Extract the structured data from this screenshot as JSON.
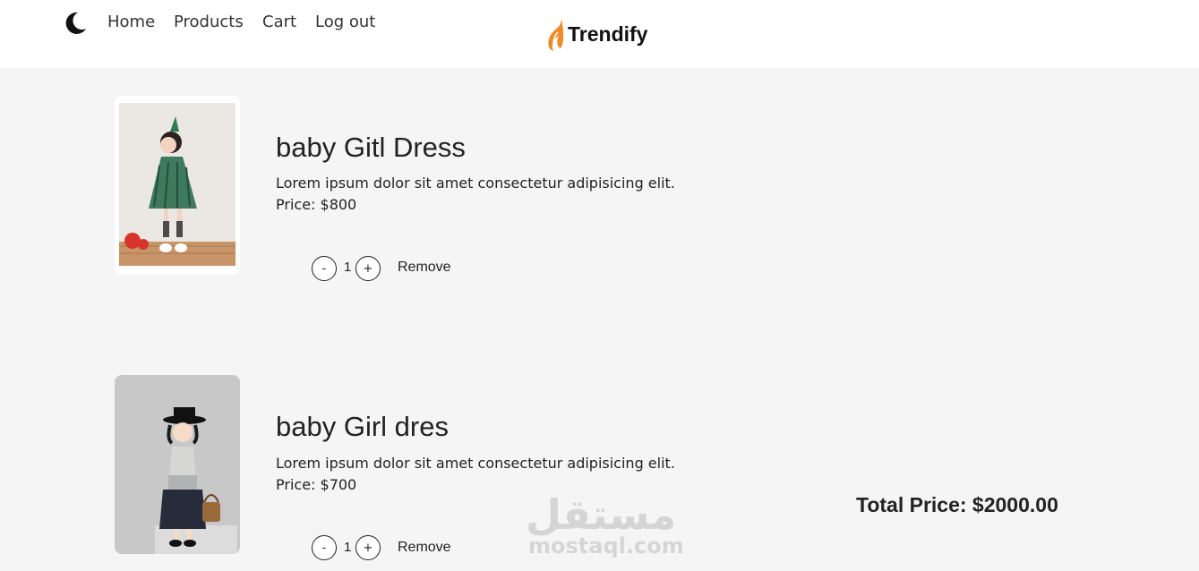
{
  "nav": {
    "links": [
      "Home",
      "Products",
      "Cart",
      "Log out"
    ],
    "brand": "Trendify"
  },
  "cart": {
    "items": [
      {
        "title": "baby Gitl Dress",
        "description": "Lorem ipsum dolor sit amet consectetur adipisicing elit.",
        "price": "Price: $800",
        "quantity": "1",
        "decrement": "-",
        "increment": "+",
        "remove": "Remove",
        "image": "girl-green-dress-photo"
      },
      {
        "title": "baby Girl dres",
        "description": "Lorem ipsum dolor sit amet consectetur adipisicing elit.",
        "price": "Price: $700",
        "quantity": "1",
        "decrement": "-",
        "increment": "+",
        "remove": "Remove",
        "image": "girl-hat-dress-photo"
      }
    ],
    "total": "Total Price: $2000.00"
  },
  "watermark": {
    "arabic": "مستقل",
    "latin": "mostaql.com"
  },
  "colors": {
    "background": "#f5f5f5",
    "navbar": "#ffffff",
    "brand_flame": "#f08a24"
  }
}
